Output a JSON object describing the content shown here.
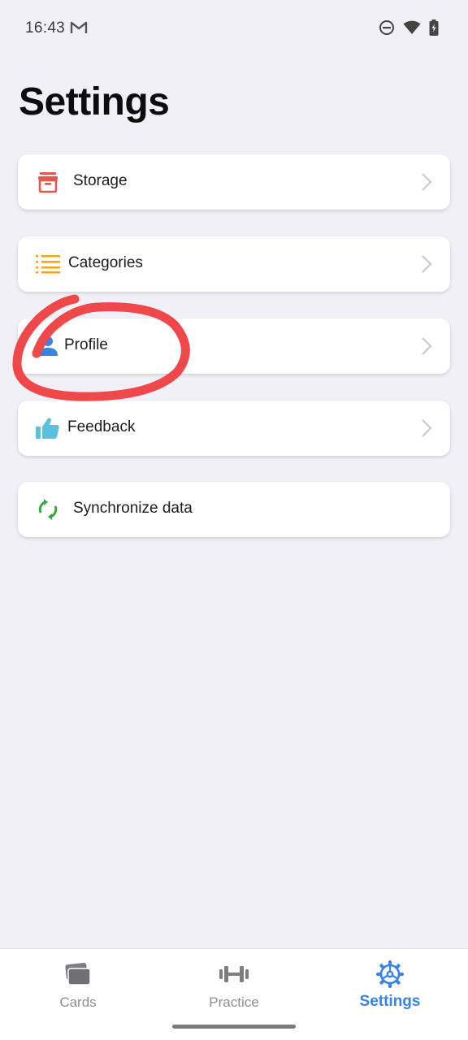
{
  "status_bar": {
    "time": "16:43",
    "icons": [
      "gmail-icon",
      "do-not-disturb-icon",
      "wifi-icon",
      "battery-charging-icon"
    ]
  },
  "page": {
    "title": "Settings"
  },
  "settings_items": [
    {
      "label": "Storage",
      "icon": "storage-box-icon",
      "icon_color": "#e0584f",
      "has_chevron": true
    },
    {
      "label": "Categories",
      "icon": "list-icon",
      "icon_color": "#f2a516",
      "has_chevron": true
    },
    {
      "label": "Profile",
      "icon": "person-icon",
      "icon_color": "#3b82e6",
      "has_chevron": true
    },
    {
      "label": "Feedback",
      "icon": "thumbs-up-icon",
      "icon_color": "#5bc0de",
      "has_chevron": true
    },
    {
      "label": "Synchronize data",
      "icon": "sync-icon",
      "icon_color": "#3aa845",
      "has_chevron": false
    }
  ],
  "annotation": {
    "color": "#f0474a",
    "highlights": "Profile"
  },
  "bottom_nav": {
    "items": [
      {
        "label": "Cards",
        "icon": "cards-icon",
        "active": false
      },
      {
        "label": "Practice",
        "icon": "dumbbell-icon",
        "active": false
      },
      {
        "label": "Settings",
        "icon": "gear-icon",
        "active": true
      }
    ],
    "active_color": "#3b82e6",
    "inactive_color": "#8e8e93"
  }
}
